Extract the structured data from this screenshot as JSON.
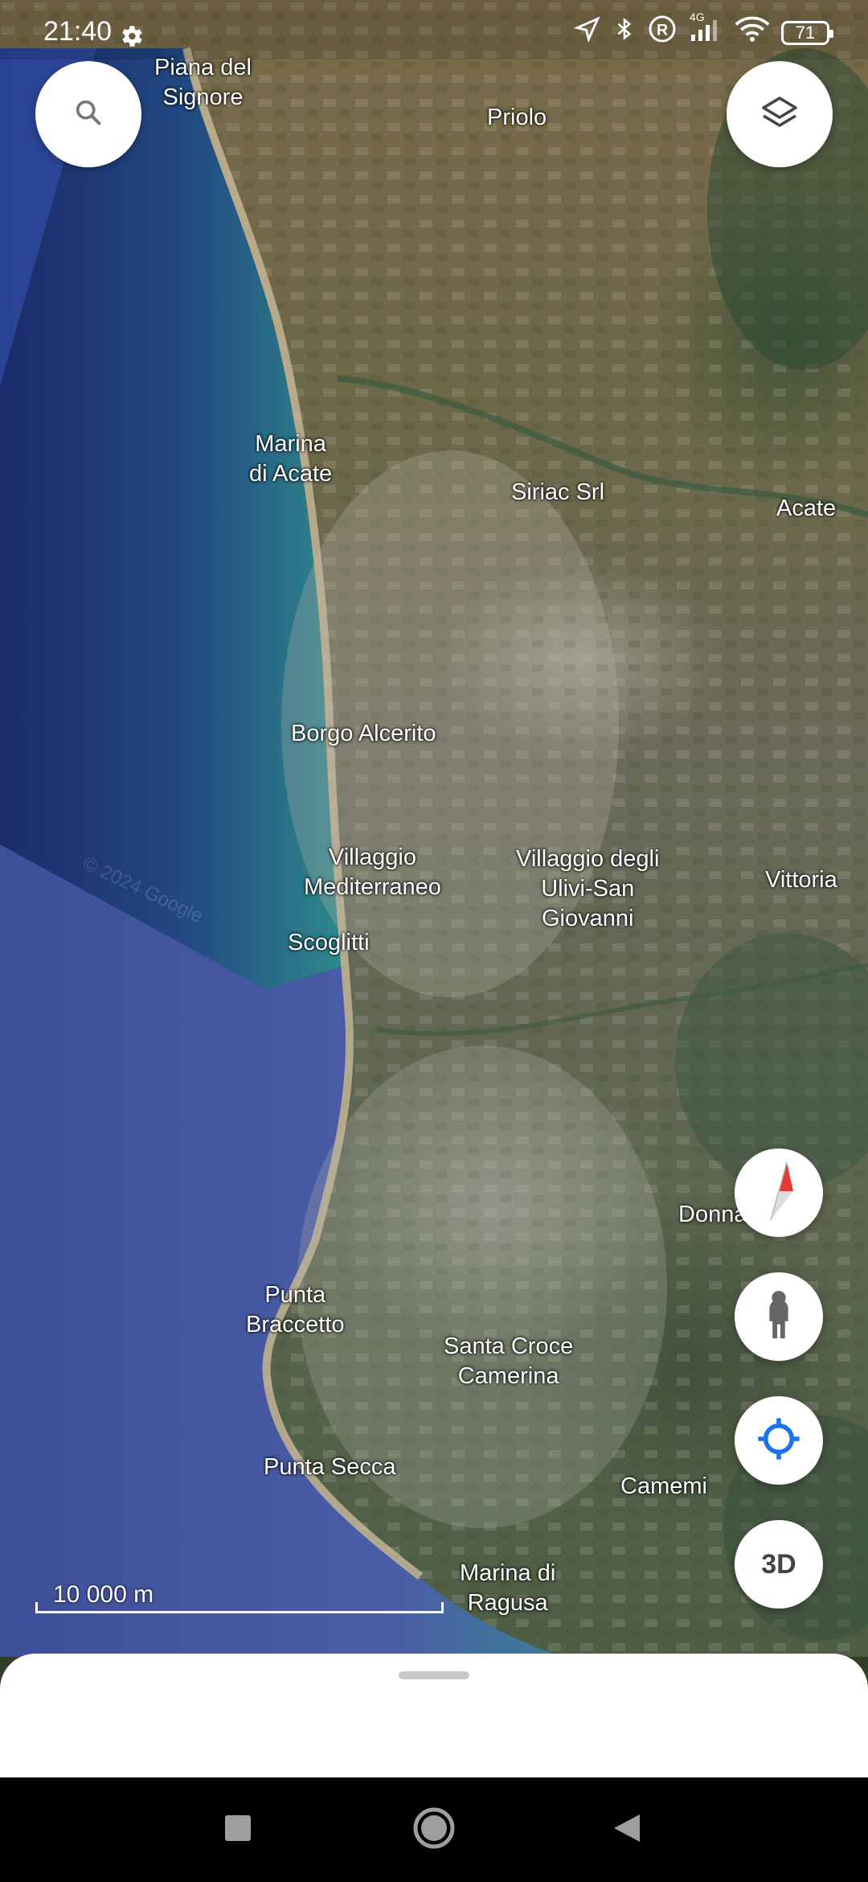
{
  "status_bar": {
    "time": "21:40",
    "settings_icon": "gear-icon",
    "network": "4G",
    "battery": "71",
    "icons": [
      "location-arrow-icon",
      "bluetooth-icon",
      "roaming-r-icon",
      "signal-icon",
      "wifi-icon",
      "battery-icon"
    ]
  },
  "controls": {
    "search_icon": "search-icon",
    "layers_icon": "layers-icon",
    "compass_icon": "compass-icon",
    "street_view_icon": "pegman-icon",
    "my_location_icon": "crosshair-icon",
    "three_d_label": "3D"
  },
  "places": {
    "piana_del_signore": "Piana del\nSignore",
    "priolo": "Priolo",
    "marina_di_acate": "Marina\ndi Acate",
    "siriac_srl": "Siriac Srl",
    "acate": "Acate",
    "borgo_alcerito": "Borgo Alcerito",
    "villaggio_mediterraneo": "Villaggio\nMediterraneo",
    "villaggio_ulivi": "Villaggio degli\nUlivi-San\nGiovanni",
    "vittoria": "Vittoria",
    "scoglitti": "Scoglitti",
    "donnafugata": "Donnafugata",
    "punta_braccetto": "Punta\nBraccetto",
    "santa_croce": "Santa Croce\nCamerina",
    "punta_secca": "Punta Secca",
    "camemi": "Camemi",
    "marina_di_ragusa": "Marina di\nRagusa"
  },
  "watermark": "© 2024 Google",
  "scale": {
    "label": "10 000 m"
  },
  "colors": {
    "sea_deep": "#1d2f6e",
    "sea_shallow": "#2f7b86",
    "land": "#6b6a52",
    "accent_blue": "#1a73e8",
    "compass_red": "#e53935"
  },
  "navbar": {
    "icons": [
      "recents-square-icon",
      "home-circle-icon",
      "back-triangle-icon"
    ]
  }
}
